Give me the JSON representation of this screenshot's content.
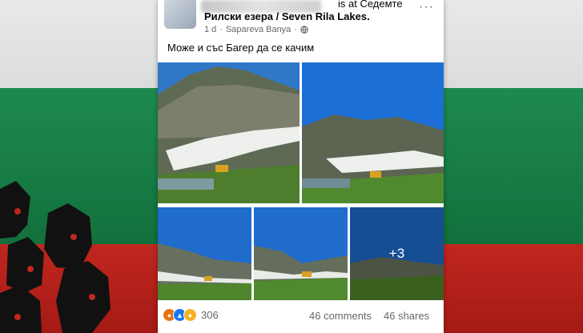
{
  "post": {
    "at_label": "is at Седемте",
    "location_line": "Рилски езера / Seven Rila Lakes.",
    "time": "1 d",
    "place": "Sapareva Banya",
    "dot": "·",
    "more": "···",
    "text": "Може и със Багер  да се качим",
    "more_photos": "+3"
  },
  "stats": {
    "reactions_count": "306",
    "comments": "46 comments",
    "shares": "46 shares"
  },
  "icons": {
    "privacy": "globe-icon",
    "reactions": [
      "angry-reaction-icon",
      "like-reaction-icon",
      "sad-reaction-icon"
    ]
  },
  "colors": {
    "flag_white": "#e9e9e9",
    "flag_green": "#16794a",
    "flag_red": "#b8221b",
    "meta_text": "#65676b"
  }
}
